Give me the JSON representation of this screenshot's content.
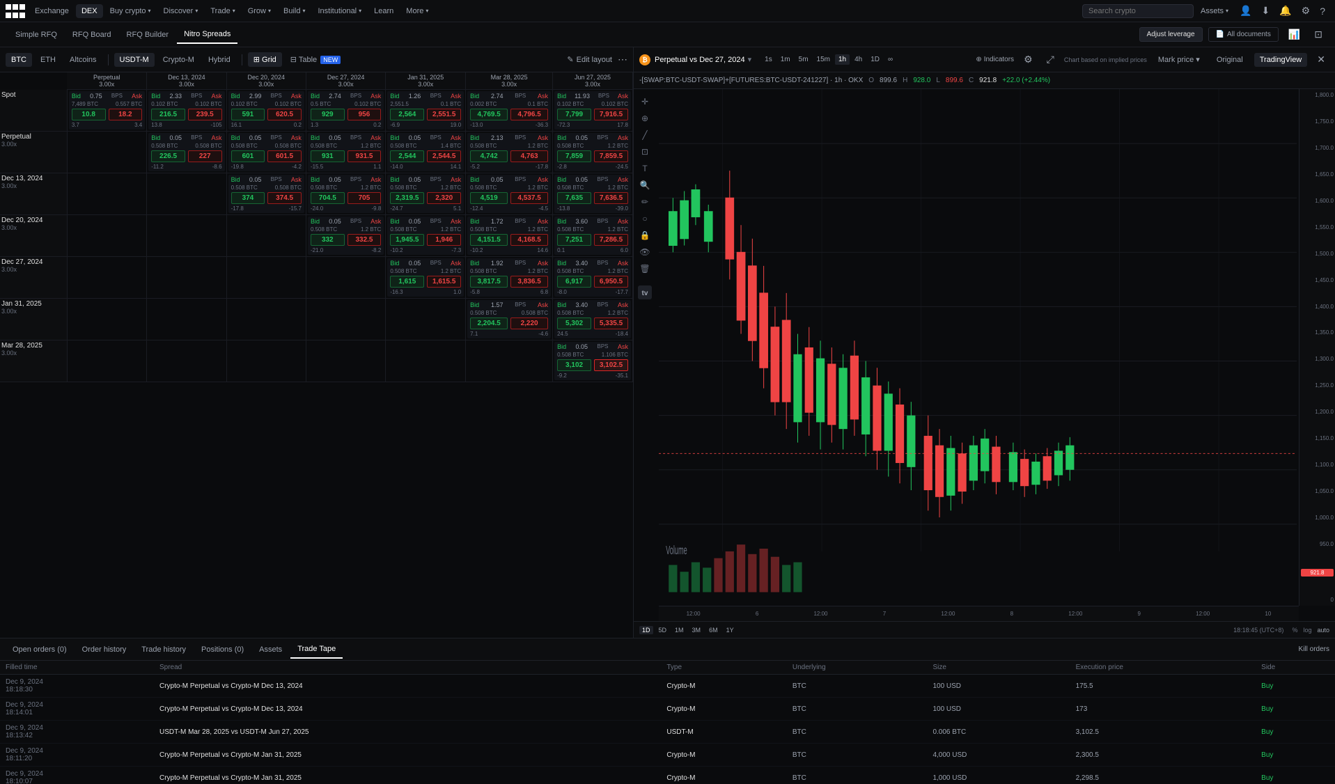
{
  "nav": {
    "logo_alt": "OKX",
    "tabs": [
      {
        "label": "Exchange",
        "active": false
      },
      {
        "label": "DEX",
        "active": true
      },
      {
        "label": "Buy crypto",
        "active": false,
        "has_chevron": true
      },
      {
        "label": "Discover",
        "active": false,
        "has_chevron": true
      },
      {
        "label": "Trade",
        "active": false,
        "has_chevron": true
      },
      {
        "label": "Grow",
        "active": false,
        "has_chevron": true
      },
      {
        "label": "Build",
        "active": false,
        "has_chevron": true
      },
      {
        "label": "Institutional",
        "active": false,
        "has_chevron": true
      },
      {
        "label": "Learn",
        "active": false
      },
      {
        "label": "More",
        "active": false,
        "has_chevron": true
      }
    ],
    "search_placeholder": "Search crypto",
    "assets_label": "Assets"
  },
  "second_nav": {
    "items": [
      {
        "label": "Simple RFQ",
        "active": false
      },
      {
        "label": "RFQ Board",
        "active": false
      },
      {
        "label": "RFQ Builder",
        "active": false
      },
      {
        "label": "Nitro Spreads",
        "active": true
      }
    ]
  },
  "left_toolbar": {
    "asset_tabs": [
      {
        "label": "BTC",
        "active": true
      },
      {
        "label": "ETH",
        "active": false
      },
      {
        "label": "Altcoins",
        "active": false
      }
    ],
    "margin_tabs": [
      {
        "label": "USDT-M",
        "active": true
      },
      {
        "label": "Crypto-M",
        "active": false
      },
      {
        "label": "Hybrid",
        "active": false
      }
    ],
    "view_tabs": [
      {
        "label": "Grid",
        "active": true,
        "icon": "⊞"
      },
      {
        "label": "Table",
        "active": false,
        "is_new": true
      }
    ],
    "edit_layout": "Edit layout"
  },
  "spread_table": {
    "row_headers": [
      {
        "name": "Spot",
        "mult": ""
      },
      {
        "name": "Perpetual",
        "mult": "3.00x"
      },
      {
        "name": "Dec 13, 2024",
        "mult": "3.00x"
      },
      {
        "name": "Dec 20, 2024",
        "mult": "3.00x"
      },
      {
        "name": "Dec 27, 2024",
        "mult": "3.00x"
      },
      {
        "name": "Jan 31, 2025",
        "mult": "3.00x"
      },
      {
        "name": "Mar 28, 2025",
        "mult": "3.00x"
      }
    ],
    "col_headers": [
      {
        "name": "Perpetual",
        "mult": "3.00x"
      },
      {
        "name": "Dec 13, 2024",
        "mult": "3.00x"
      },
      {
        "name": "Dec 20, 2024",
        "mult": "3.00x"
      },
      {
        "name": "Dec 27, 2024",
        "mult": "3.00x"
      },
      {
        "name": "Jan 31, 2025",
        "mult": "3.00x"
      },
      {
        "name": "Mar 28, 2025",
        "mult": "3.00x"
      },
      {
        "name": "Jun 27, 2025",
        "mult": "3.00x"
      }
    ],
    "cells": {
      "spot_perp": {
        "bid_bps": "0.75",
        "ask_bps": "BPS",
        "bid_size": "7,489 BTC",
        "ask_size": "0.557 BTC",
        "bid": "10.8",
        "ask": "18.2",
        "bid_chg": "3.7",
        "ask_chg": "3.4"
      },
      "spot_dec13": {
        "bid_bps": "2.33",
        "ask_bps": "BPS",
        "bid_size": "0.102 BTC",
        "ask_size": "0.102 BTC",
        "bid": "216.5",
        "ask": "239.5",
        "bid_chg": "13.8",
        "ask_chg": "-105"
      },
      "spot_dec20": {
        "bid_bps": "2.99",
        "ask_bps": "BPS",
        "bid_size": "0.102 BTC",
        "ask_size": "0.102 BTC",
        "bid": "591",
        "ask": "620.5",
        "bid_chg": "16.1",
        "ask_chg": "0.2"
      },
      "spot_dec27": {
        "bid_bps": "2.74",
        "ask_bps": "BPS",
        "bid_size": "0.5 BTC",
        "ask_size": "0.102 BTC",
        "bid": "929",
        "ask": "956",
        "bid_chg": "1.3",
        "ask_chg": "0.2"
      },
      "spot_jan31": {
        "bid_bps": "1.26",
        "ask_bps": "BPS",
        "bid_size": "2,551.5",
        "ask_size": "0.1 BTC",
        "bid": "2,564",
        "ask_size2": "0.1 BTC",
        "bid_chg": "-6.9",
        "ask_chg": "19.0"
      },
      "spot_mar28": {
        "bid_bps": "2.74",
        "ask_bps": "BPS",
        "bid_size": "0.002 BTC",
        "ask_size": "0.1 BTC",
        "bid": "4,769.5",
        "ask": "4,796.5",
        "bid_chg": "-13.0",
        "ask_chg": "-36.3"
      },
      "spot_jun27": {
        "bid_bps": "11.93",
        "ask_bps": "BPS",
        "bid_size": "0.102 BTC",
        "ask_size": "0.102 BTC",
        "bid": "7,799",
        "ask": "7,916.5",
        "bid_chg": "-72.3",
        "ask_chg": "17.8"
      }
    }
  },
  "chart": {
    "symbol": "Perpetual vs Dec 27, 2024",
    "symbol_icon": "₿",
    "price_label": "-[SWAP:BTC-USDT-SWAP]+[FUTURES:BTC-USDT-241227] · 1h · OKX",
    "o_price": "899.6",
    "h_price": "928.0",
    "l_price": "899.6",
    "c_price": "921.8",
    "chg": "+22.0 (+2.44%)",
    "timeframes": [
      "1s",
      "1m",
      "5m",
      "15m",
      "1h",
      "4h",
      "1D",
      "∞"
    ],
    "active_tf": "1h",
    "indicators_label": "Indicators",
    "mark_price_label": "Mark price",
    "original_label": "Original",
    "tradingview_label": "TradingView",
    "implied_text": "Chart based on implied prices",
    "y_labels": [
      "1,800.0",
      "1,750.0",
      "1,700.0",
      "1,650.0",
      "1,600.0",
      "1,550.0",
      "1,500.0",
      "1,450.0",
      "1,400.0",
      "1,350.0",
      "1,300.0",
      "1,250.0",
      "1,200.0",
      "1,150.0",
      "1,100.0",
      "1,050.0",
      "1,000.0",
      "950.0",
      "0"
    ],
    "x_labels": [
      "12:00",
      "6",
      "12:00",
      "7",
      "12:00",
      "8",
      "12:00",
      "9",
      "12:00",
      "10"
    ],
    "volume_label": "Volume",
    "current_price_badge": "921.8",
    "time_ranges": [
      "1D",
      "5D",
      "1M",
      "3M",
      "6M",
      "1Y"
    ],
    "timestamp": "18:18:45 (UTC+8)",
    "adjust_leverage": "Adjust leverage",
    "all_documents": "All documents"
  },
  "bottom_panel": {
    "tabs": [
      {
        "label": "Open orders (0)",
        "active": false
      },
      {
        "label": "Order history",
        "active": false
      },
      {
        "label": "Trade history",
        "active": false
      },
      {
        "label": "Positions (0)",
        "active": false
      },
      {
        "label": "Assets",
        "active": false
      },
      {
        "label": "Trade Tape",
        "active": true
      }
    ],
    "columns": [
      "Filled time",
      "Spread",
      "Type",
      "Underlying",
      "Size",
      "Execution price",
      "Side"
    ],
    "kill_orders": "Kill orders",
    "rows": [
      {
        "time": "Dec 9, 2024\n18:18:30",
        "spread": "Crypto-M Perpetual vs Crypto-M Dec 13, 2024",
        "type": "Crypto-M",
        "underlying": "BTC",
        "size": "100 USD",
        "exec_price": "175.5",
        "side": "Buy"
      },
      {
        "time": "Dec 9, 2024\n18:14:01",
        "spread": "Crypto-M Perpetual vs Crypto-M Dec 13, 2024",
        "type": "Crypto-M",
        "underlying": "BTC",
        "size": "100 USD",
        "exec_price": "173",
        "side": "Buy"
      },
      {
        "time": "Dec 9, 2024\n18:13:42",
        "spread": "USDT-M Mar 28, 2025 vs USDT-M Jun 27, 2025",
        "type": "USDT-M",
        "underlying": "BTC",
        "size": "0.006 BTC",
        "exec_price": "3,102.5",
        "side": "Buy"
      },
      {
        "time": "Dec 9, 2024\n18:11:20",
        "spread": "Crypto-M Perpetual vs Crypto-M Jan 31, 2025",
        "type": "Crypto-M",
        "underlying": "BTC",
        "size": "4,000 USD",
        "exec_price": "2,300.5",
        "side": "Buy"
      },
      {
        "time": "Dec 9, 2024\n18:10:07",
        "spread": "Crypto-M Perpetual vs Crypto-M Jan 31, 2025",
        "type": "Crypto-M",
        "underlying": "BTC",
        "size": "1,000 USD",
        "exec_price": "2,298.5",
        "side": "Buy"
      }
    ]
  }
}
